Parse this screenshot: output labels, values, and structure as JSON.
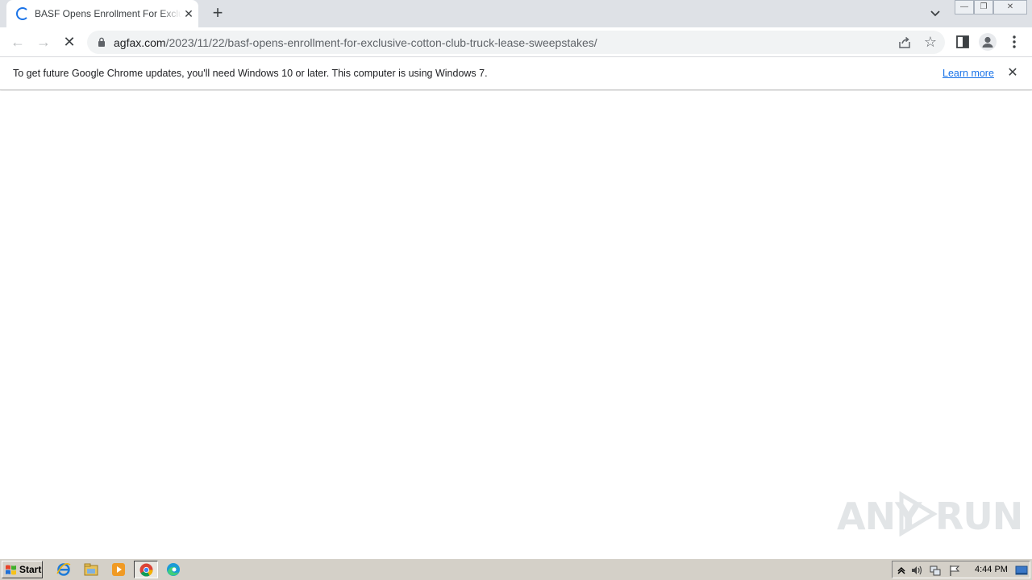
{
  "browser": {
    "tab": {
      "title": "BASF Opens Enrollment For Exclusive Cotton Club Truck Lease Sweepstakes",
      "close_label": "✕"
    },
    "new_tab_label": "+",
    "window_controls": {
      "minimize": "—",
      "restore": "❐",
      "close": "✕"
    },
    "address": {
      "host": "agfax.com",
      "path": "/2023/11/22/basf-opens-enrollment-for-exclusive-cotton-club-truck-lease-sweepstakes/"
    },
    "nav": {
      "back": "←",
      "forward": "→",
      "stop": "✕"
    },
    "infobar": {
      "message": "To get future Google Chrome updates, you'll need Windows 10 or later. This computer is using Windows 7.",
      "link": "Learn more",
      "close": "✕"
    }
  },
  "watermark": {
    "left_text": "ANY",
    "right_text": "RUN"
  },
  "taskbar": {
    "start_label": "Start",
    "clock": "4:44 PM",
    "quick_launch": [
      "ie-icon",
      "explorer-icon",
      "media-player-icon",
      "chrome-icon",
      "edge-icon"
    ]
  },
  "colors": {
    "accent": "#1a73e8",
    "tabstrip": "#dee1e6",
    "taskbar": "#d4d0c8"
  }
}
